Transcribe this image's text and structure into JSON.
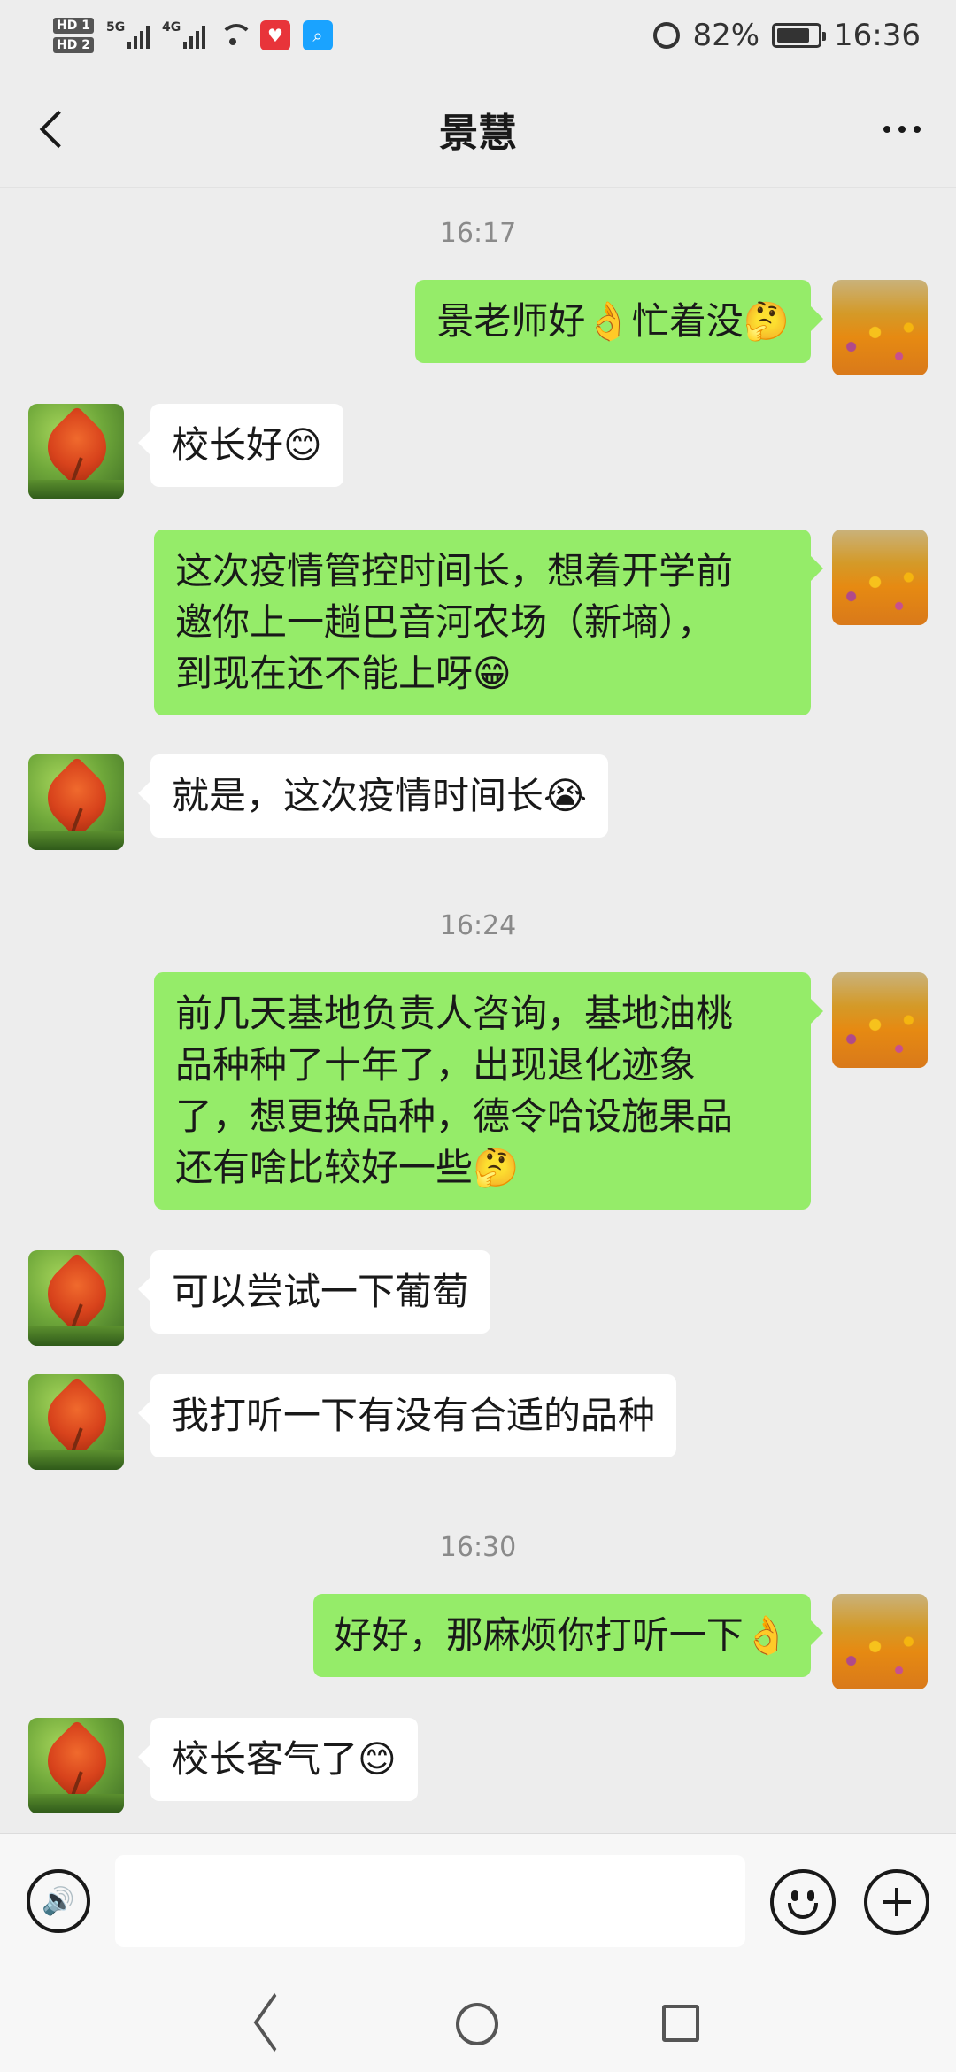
{
  "status_bar": {
    "hd1": "HD 1",
    "hd2": "HD 2",
    "net1": "5G",
    "net2": "4G",
    "battery": "82%",
    "time": "16:36",
    "battery_level": 0.82
  },
  "header": {
    "title": "景慧"
  },
  "timestamps": [
    "16:17",
    "16:24",
    "16:30"
  ],
  "messages": [
    {
      "side": "right",
      "text": "景老师好👌忙着没🤔"
    },
    {
      "side": "left",
      "text": "校长好😊"
    },
    {
      "side": "right",
      "text": "这次疫情管控时间长，想着开学前\n邀你上一趟巴音河农场（新墒），\n到现在还不能上呀😁"
    },
    {
      "side": "left",
      "text": "就是，这次疫情时间长😭"
    },
    {
      "side": "right",
      "text": "前几天基地负责人咨询，基地油桃\n品种种了十年了，出现退化迹象\n了，想更换品种，德令哈设施果品\n还有啥比较好一些🤔"
    },
    {
      "side": "left",
      "text": "可以尝试一下葡萄"
    },
    {
      "side": "left",
      "text": "我打听一下有没有合适的品种"
    },
    {
      "side": "right",
      "text": "好好，那麻烦你打听一下👌"
    },
    {
      "side": "left",
      "text": "校长客气了😊"
    }
  ],
  "input": {
    "value": "",
    "placeholder": ""
  },
  "icons": {
    "back": "back-chevron-icon",
    "more": "more-dots-icon",
    "voice": "voice-icon",
    "emoji": "emoji-icon",
    "plus": "plus-icon"
  },
  "colors": {
    "sent_bubble": "#95ec69",
    "received_bubble": "#ffffff",
    "background": "#ededed"
  }
}
